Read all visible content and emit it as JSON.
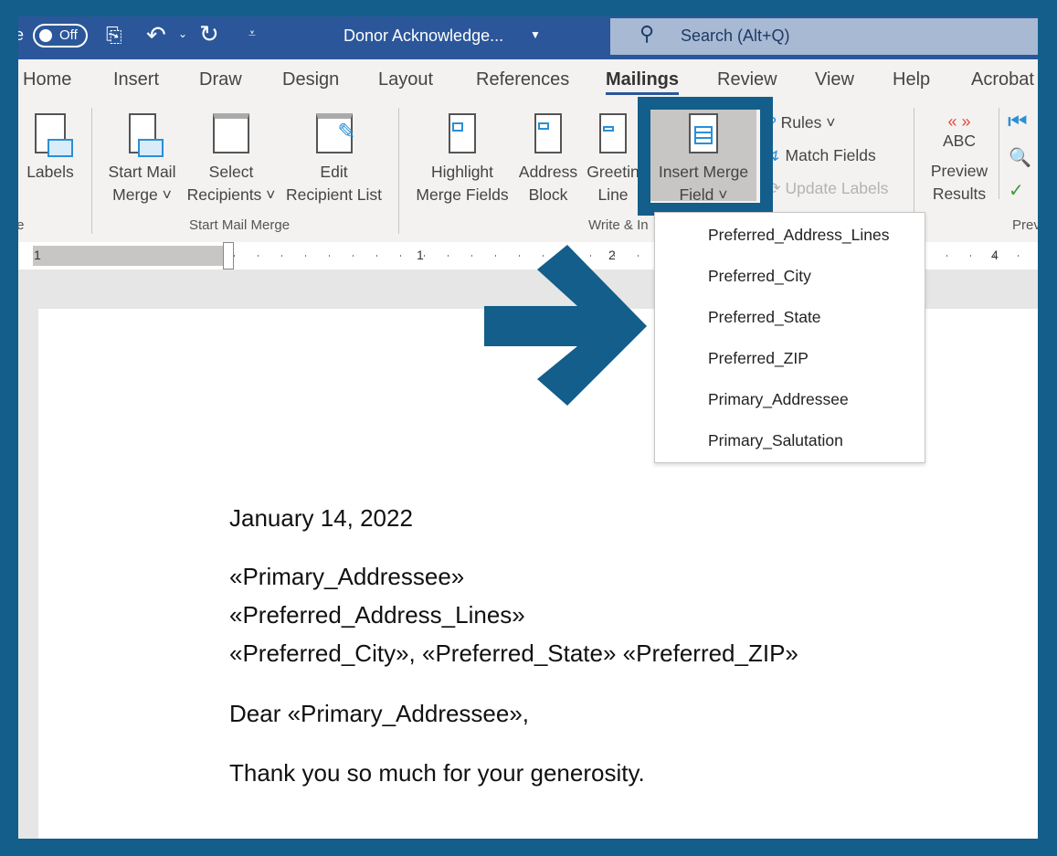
{
  "titlebar": {
    "autosave_partial": "e",
    "autosave_toggle": "Off",
    "doc_title": "Donor Acknowledge...",
    "search_placeholder": "Search (Alt+Q)"
  },
  "tabs": [
    "Home",
    "Insert",
    "Draw",
    "Design",
    "Layout",
    "References",
    "Mailings",
    "Review",
    "View",
    "Help",
    "Acrobat"
  ],
  "active_tab": "Mailings",
  "ribbon": {
    "labels": "Labels",
    "start_mail_merge": [
      "Start Mail",
      "Merge"
    ],
    "select_recipients": [
      "Select",
      "Recipients"
    ],
    "edit_recipient_list": [
      "Edit",
      "Recipient List"
    ],
    "highlight": [
      "Highlight",
      "Merge Fields"
    ],
    "address_block": [
      "Address",
      "Block"
    ],
    "greeting_line": [
      "Greetin",
      "Line"
    ],
    "insert_merge_field": [
      "Insert Merge",
      "Field"
    ],
    "rules": "Rules",
    "match_fields": "Match Fields",
    "update_labels": "Update Labels",
    "preview_abc": "ABC",
    "preview_results": [
      "Preview",
      "Results"
    ],
    "groups": {
      "create_partial": "te",
      "start_mail_merge": "Start Mail Merge",
      "write_insert": "Write & In",
      "preview_partial": "Prev"
    }
  },
  "ruler": {
    "labels": [
      "1",
      "1",
      "2",
      "4"
    ]
  },
  "dropdown": {
    "items": [
      "Preferred_Address_Lines",
      "Preferred_City",
      "Preferred_State",
      "Preferred_ZIP",
      "Primary_Addressee",
      "Primary_Salutation"
    ]
  },
  "document": {
    "lines": [
      "January 14, 2022",
      "«Primary_Addressee»",
      "«Preferred_Address_Lines»",
      "«Preferred_City», «Preferred_State»  «Preferred_ZIP»",
      "Dear «Primary_Addressee»,",
      "Thank you so much for your generosity."
    ]
  },
  "colors": {
    "frame": "#135e8a",
    "titlebar": "#2b579a",
    "search": "#a7b9d3"
  }
}
